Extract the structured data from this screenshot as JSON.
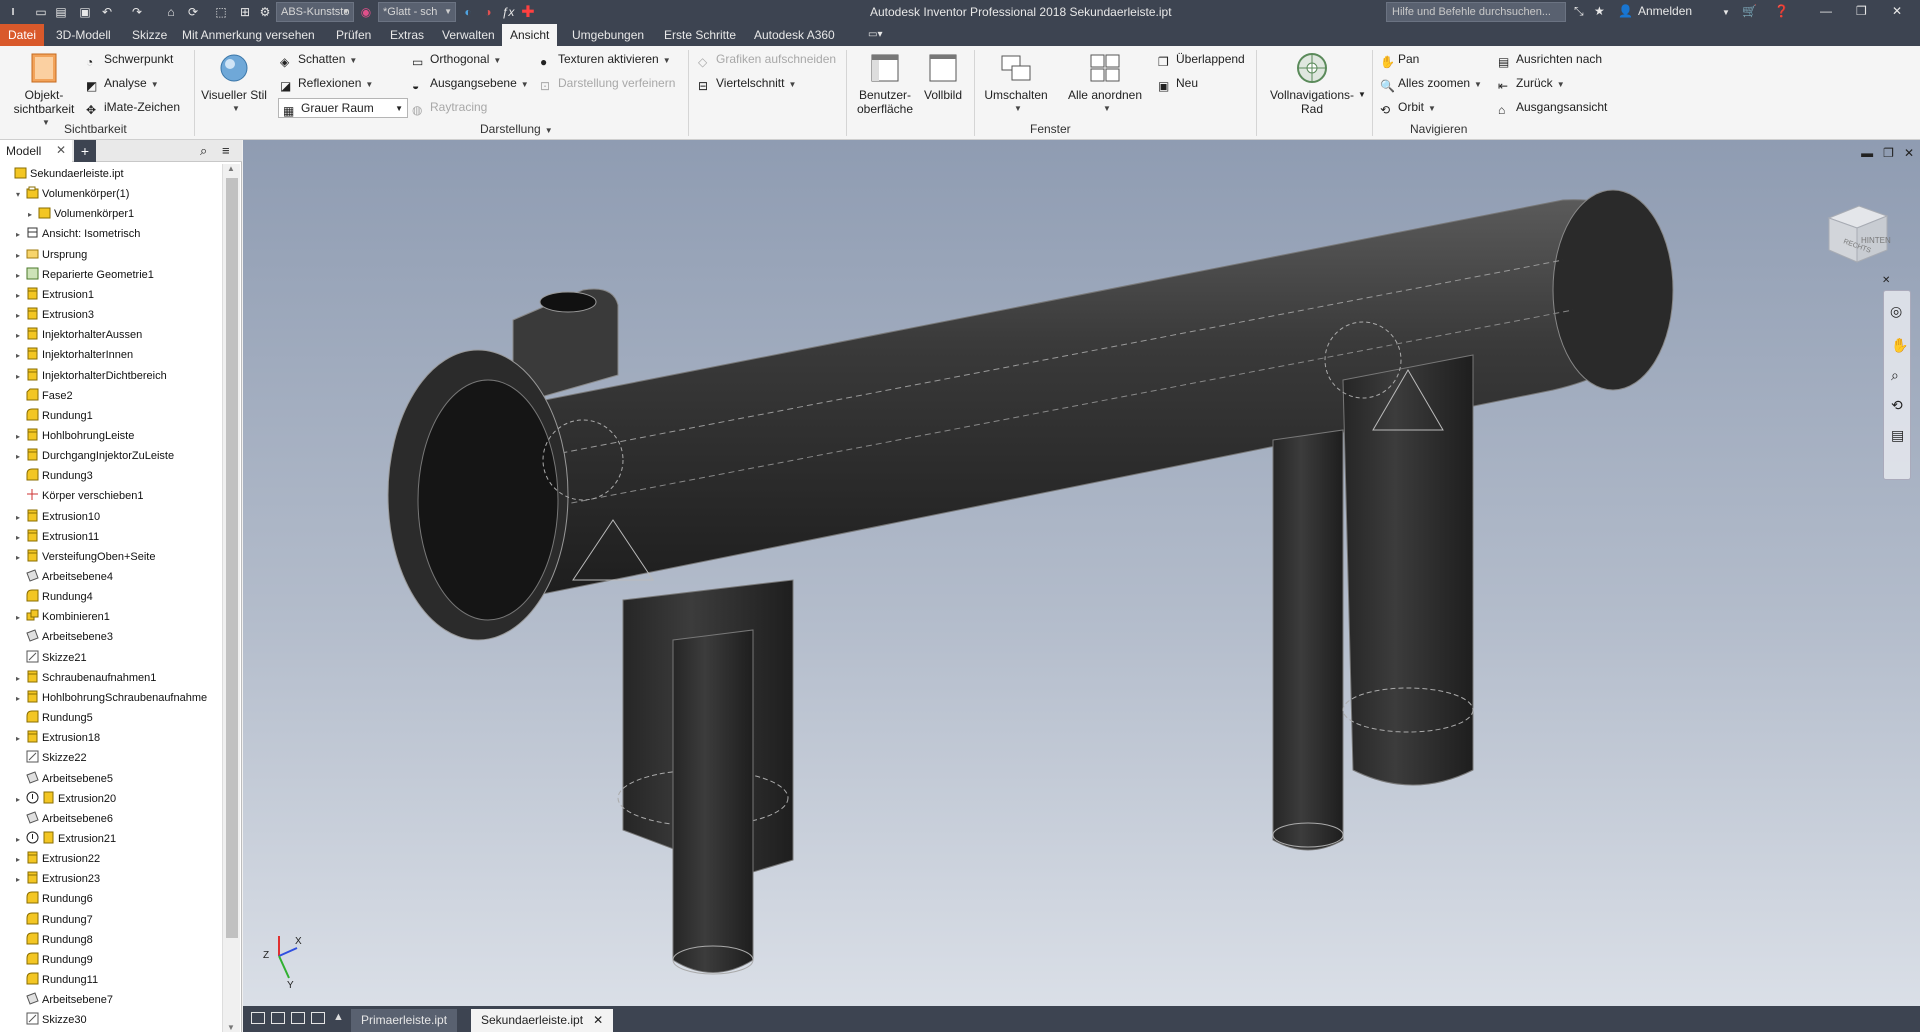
{
  "titlebar": {
    "material": "ABS-Kunststo",
    "appearance": "*Glatt - sch",
    "title": "Autodesk Inventor Professional 2018    Sekundaerleiste.ipt",
    "help_placeholder": "Hilfe und Befehle durchsuchen...",
    "signin": "Anmelden",
    "icons": [
      "new-icon",
      "open-icon",
      "save-icon",
      "undo-icon",
      "redo-icon",
      "home-icon",
      "update-icon",
      "select-icon",
      "material-icon",
      "appearance-icon",
      "fx-icon",
      "add-icon",
      "help-icon"
    ]
  },
  "menu": {
    "tabs": [
      "Datei",
      "3D-Modell",
      "Skizze",
      "Mit Anmerkung versehen",
      "Prüfen",
      "Extras",
      "Verwalten",
      "Ansicht",
      "Umgebungen",
      "Erste Schritte",
      "Autodesk A360"
    ],
    "active": "Ansicht"
  },
  "ribbon": {
    "sichtbarkeit": {
      "label": "Sichtbarkeit",
      "object_visibility": "Objekt-\nsichtbarkeit",
      "center_of_gravity": "Schwerpunkt",
      "analysis": "Analyse",
      "imate": "iMate-Zeichen"
    },
    "darstellung": {
      "label": "Darstellung",
      "visual_style": "Visueller Stil",
      "shadows": "Schatten",
      "reflections": "Reflexionen",
      "lighting_style": "Grauer Raum",
      "orthographic": "Orthogonal",
      "ground_plane": "Ausgangsebene",
      "raytracing": "Raytracing",
      "textures": "Texturen aktivieren",
      "refine_display": "Darstellung verfeinern",
      "clip_graphics": "Grafiken aufschneiden",
      "quarter_section": "Viertelschnitt"
    },
    "fenster": {
      "label": "Fenster",
      "user_interface": "Benutzer-\noberfläche",
      "full_screen": "Vollbild",
      "switch": "Umschalten",
      "arrange_all": "Alle anordnen",
      "cascade": "Überlappend",
      "new": "Neu"
    },
    "navigieren": {
      "label": "Navigieren",
      "full_nav_wheel": "Vollnavigations-\nRad",
      "pan": "Pan",
      "zoom_all": "Alles zoomen",
      "orbit": "Orbit",
      "look_at": "Ausrichten nach",
      "previous": "Zurück",
      "home_view": "Ausgangsansicht"
    }
  },
  "browser": {
    "tab": "Modell",
    "tree": [
      {
        "label": "Sekundaerleiste.ipt",
        "indent": 0,
        "twisty": "",
        "icon": "part"
      },
      {
        "label": "Volumenkörper(1)",
        "indent": 1,
        "twisty": "v",
        "icon": "bodies"
      },
      {
        "label": "Volumenkörper1",
        "indent": 2,
        "twisty": ">",
        "icon": "body"
      },
      {
        "label": "Ansicht: Isometrisch",
        "indent": 1,
        "twisty": ">",
        "icon": "view"
      },
      {
        "label": "Ursprung",
        "indent": 1,
        "twisty": ">",
        "icon": "folder"
      },
      {
        "label": "Reparierte Geometrie1",
        "indent": 1,
        "twisty": ">",
        "icon": "repair"
      },
      {
        "label": "Extrusion1",
        "indent": 1,
        "twisty": ">",
        "icon": "extrude"
      },
      {
        "label": "Extrusion3",
        "indent": 1,
        "twisty": ">",
        "icon": "extrude"
      },
      {
        "label": "InjektorhalterAussen",
        "indent": 1,
        "twisty": ">",
        "icon": "extrude"
      },
      {
        "label": "InjektorhalterInnen",
        "indent": 1,
        "twisty": ">",
        "icon": "extrude"
      },
      {
        "label": "InjektorhalterDichtbereich",
        "indent": 1,
        "twisty": ">",
        "icon": "extrude"
      },
      {
        "label": "Fase2",
        "indent": 1,
        "twisty": "",
        "icon": "chamfer"
      },
      {
        "label": "Rundung1",
        "indent": 1,
        "twisty": "",
        "icon": "fillet"
      },
      {
        "label": "HohlbohrungLeiste",
        "indent": 1,
        "twisty": ">",
        "icon": "extrude"
      },
      {
        "label": "DurchgangInjektorZuLeiste",
        "indent": 1,
        "twisty": ">",
        "icon": "extrude"
      },
      {
        "label": "Rundung3",
        "indent": 1,
        "twisty": "",
        "icon": "fillet"
      },
      {
        "label": "Körper verschieben1",
        "indent": 1,
        "twisty": "",
        "icon": "move"
      },
      {
        "label": "Extrusion10",
        "indent": 1,
        "twisty": ">",
        "icon": "extrude"
      },
      {
        "label": "Extrusion11",
        "indent": 1,
        "twisty": ">",
        "icon": "extrude"
      },
      {
        "label": "VersteifungOben+Seite",
        "indent": 1,
        "twisty": ">",
        "icon": "extrude"
      },
      {
        "label": "Arbeitsebene4",
        "indent": 1,
        "twisty": "",
        "icon": "plane"
      },
      {
        "label": "Rundung4",
        "indent": 1,
        "twisty": "",
        "icon": "fillet"
      },
      {
        "label": "Kombinieren1",
        "indent": 1,
        "twisty": ">",
        "icon": "combine"
      },
      {
        "label": "Arbeitsebene3",
        "indent": 1,
        "twisty": "",
        "icon": "plane"
      },
      {
        "label": "Skizze21",
        "indent": 1,
        "twisty": "",
        "icon": "sketch"
      },
      {
        "label": "Schraubenaufnahmen1",
        "indent": 1,
        "twisty": ">",
        "icon": "extrude"
      },
      {
        "label": "HohlbohrungSchraubenaufnahme",
        "indent": 1,
        "twisty": ">",
        "icon": "extrude"
      },
      {
        "label": "Rundung5",
        "indent": 1,
        "twisty": "",
        "icon": "fillet"
      },
      {
        "label": "Extrusion18",
        "indent": 1,
        "twisty": ">",
        "icon": "extrude"
      },
      {
        "label": "Skizze22",
        "indent": 1,
        "twisty": "",
        "icon": "sketch"
      },
      {
        "label": "Arbeitsebene5",
        "indent": 1,
        "twisty": "",
        "icon": "plane"
      },
      {
        "label": "Extrusion20",
        "indent": 1,
        "twisty": ">",
        "icon": "extrude-warn"
      },
      {
        "label": "Arbeitsebene6",
        "indent": 1,
        "twisty": "",
        "icon": "plane"
      },
      {
        "label": "Extrusion21",
        "indent": 1,
        "twisty": ">",
        "icon": "extrude-warn"
      },
      {
        "label": "Extrusion22",
        "indent": 1,
        "twisty": ">",
        "icon": "extrude"
      },
      {
        "label": "Extrusion23",
        "indent": 1,
        "twisty": ">",
        "icon": "extrude"
      },
      {
        "label": "Rundung6",
        "indent": 1,
        "twisty": "",
        "icon": "fillet"
      },
      {
        "label": "Rundung7",
        "indent": 1,
        "twisty": "",
        "icon": "fillet"
      },
      {
        "label": "Rundung8",
        "indent": 1,
        "twisty": "",
        "icon": "fillet"
      },
      {
        "label": "Rundung9",
        "indent": 1,
        "twisty": "",
        "icon": "fillet"
      },
      {
        "label": "Rundung11",
        "indent": 1,
        "twisty": "",
        "icon": "fillet"
      },
      {
        "label": "Arbeitsebene7",
        "indent": 1,
        "twisty": "",
        "icon": "plane"
      },
      {
        "label": "Skizze30",
        "indent": 1,
        "twisty": "",
        "icon": "sketch"
      }
    ]
  },
  "viewport": {
    "viewcube_faces": [
      "RECHTS",
      "HINTEN"
    ],
    "triad_labels": [
      "X",
      "Y",
      "Z"
    ]
  },
  "doctabs": {
    "tabs": [
      {
        "label": "Primaerleiste.ipt",
        "active": false
      },
      {
        "label": "Sekundaerleiste.ipt",
        "active": true
      }
    ]
  },
  "colors": {
    "frame": "#3d4451",
    "file_tab": "#d9592b",
    "ribbon": "#f5f5f5",
    "part_icon": "#f3c623",
    "model": "#2c2c2c"
  }
}
